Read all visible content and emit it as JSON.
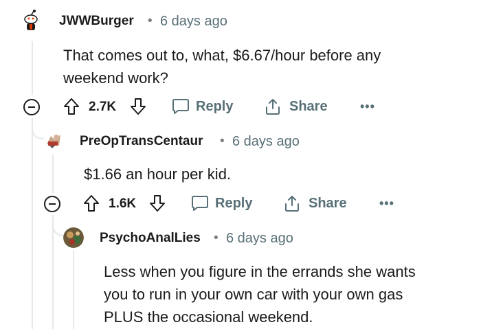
{
  "comments": [
    {
      "username": "JWWBurger",
      "separator": "•",
      "time": "6 days ago",
      "body_lines": [
        "That comes out to, what, $6.67/hour before any",
        "weekend work?"
      ],
      "score": "2.7K",
      "reply_label": "Reply",
      "share_label": "Share",
      "more_label": "•••"
    },
    {
      "username": "PreOpTransCentaur",
      "separator": "•",
      "time": "6 days ago",
      "body_lines": [
        "$1.66 an hour per kid."
      ],
      "score": "1.6K",
      "reply_label": "Reply",
      "share_label": "Share",
      "more_label": "•••"
    },
    {
      "username": "PsychoAnalLies",
      "separator": "•",
      "time": "6 days ago",
      "body_lines": [
        "Less when you figure in the errands she wants",
        "you to run in your own car with your own gas",
        "PLUS the occasional weekend."
      ]
    }
  ],
  "icons": {
    "collapse": "collapse-icon",
    "upvote": "upvote-arrow-icon",
    "downvote": "downvote-arrow-icon",
    "reply": "speech-bubble-icon",
    "share": "share-upload-icon",
    "more": "ellipsis-icon"
  },
  "colors": {
    "text": "#1a1a1b",
    "meta": "#576f76",
    "thread_line": "#e6e8ea"
  }
}
